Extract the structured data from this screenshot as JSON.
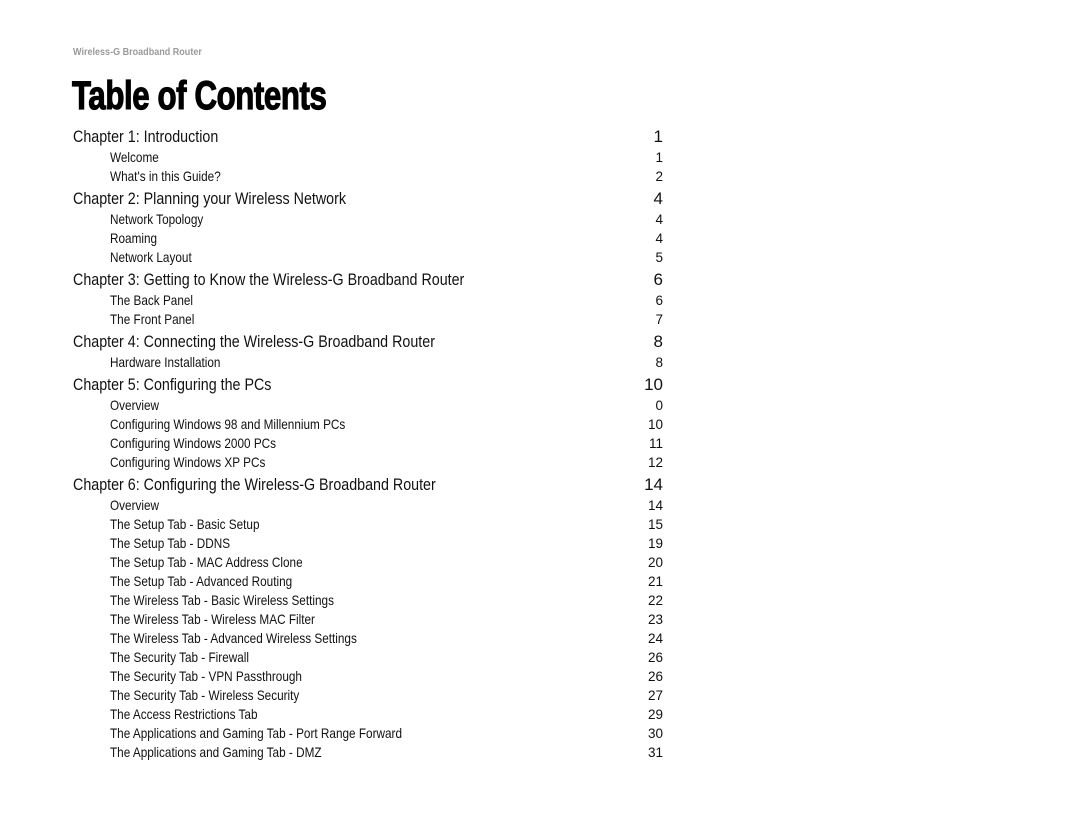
{
  "header": {
    "running_title": "Wireless-G Broadband Router"
  },
  "title": "Table of Contents",
  "toc": [
    {
      "type": "chapter",
      "label": "Chapter 1: Introduction",
      "page": "1"
    },
    {
      "type": "section",
      "label": "Welcome",
      "page": "1"
    },
    {
      "type": "section",
      "label": "What's in this Guide?",
      "page": "2"
    },
    {
      "type": "chapter",
      "label": "Chapter 2: Planning your Wireless Network",
      "page": "4"
    },
    {
      "type": "section",
      "label": "Network Topology",
      "page": "4"
    },
    {
      "type": "section",
      "label": "Roaming",
      "page": "4"
    },
    {
      "type": "section",
      "label": "Network Layout",
      "page": "5"
    },
    {
      "type": "chapter",
      "label": "Chapter 3: Getting to Know the Wireless-G Broadband Router",
      "page": "6"
    },
    {
      "type": "section",
      "label": "The Back Panel",
      "page": "6"
    },
    {
      "type": "section",
      "label": "The Front Panel",
      "page": "7"
    },
    {
      "type": "chapter",
      "label": "Chapter 4: Connecting the Wireless-G Broadband Router",
      "page": "8"
    },
    {
      "type": "section",
      "label": "Hardware Installation",
      "page": "8"
    },
    {
      "type": "chapter",
      "label": "Chapter 5: Configuring the PCs",
      "page": "10"
    },
    {
      "type": "section",
      "label": "Overview",
      "page": "0"
    },
    {
      "type": "section",
      "label": "Configuring Windows 98 and Millennium PCs",
      "page": "10"
    },
    {
      "type": "section",
      "label": "Configuring Windows 2000 PCs",
      "page": "11"
    },
    {
      "type": "section",
      "label": "Configuring Windows XP PCs",
      "page": "12"
    },
    {
      "type": "chapter",
      "label": "Chapter 6: Configuring the Wireless-G Broadband Router",
      "page": "14"
    },
    {
      "type": "section",
      "label": "Overview",
      "page": "14"
    },
    {
      "type": "section",
      "label": "The Setup Tab - Basic Setup",
      "page": "15"
    },
    {
      "type": "section",
      "label": "The Setup Tab - DDNS",
      "page": "19"
    },
    {
      "type": "section",
      "label": "The Setup Tab - MAC Address Clone",
      "page": "20"
    },
    {
      "type": "section",
      "label": "The Setup Tab - Advanced Routing",
      "page": "21"
    },
    {
      "type": "section",
      "label": "The Wireless Tab - Basic Wireless Settings",
      "page": "22"
    },
    {
      "type": "section",
      "label": "The Wireless Tab - Wireless MAC Filter",
      "page": "23"
    },
    {
      "type": "section",
      "label": "The Wireless Tab - Advanced Wireless Settings",
      "page": "24"
    },
    {
      "type": "section",
      "label": "The Security Tab - Firewall",
      "page": "26"
    },
    {
      "type": "section",
      "label": "The Security Tab - VPN Passthrough",
      "page": "26"
    },
    {
      "type": "section",
      "label": "The Security Tab - Wireless Security",
      "page": "27"
    },
    {
      "type": "section",
      "label": "The Access Restrictions Tab",
      "page": "29"
    },
    {
      "type": "section",
      "label": "The Applications and Gaming Tab - Port Range Forward",
      "page": "30"
    },
    {
      "type": "section",
      "label": "The Applications and Gaming Tab - DMZ",
      "page": "31"
    }
  ]
}
